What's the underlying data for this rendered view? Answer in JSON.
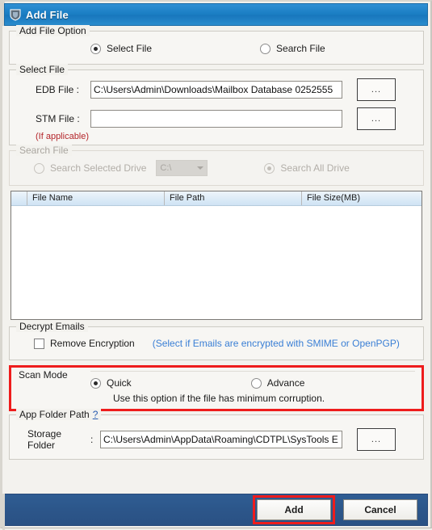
{
  "window": {
    "title": "Add File",
    "title_icon": "shield-icon"
  },
  "add_file_option": {
    "legend": "Add File Option",
    "options": [
      {
        "label": "Select File",
        "selected": true
      },
      {
        "label": "Search File",
        "selected": false
      }
    ]
  },
  "select_file": {
    "legend": "Select File",
    "edb": {
      "label": "EDB File :",
      "value": "C:\\Users\\Admin\\Downloads\\Mailbox Database 0252555",
      "browse_label": "..."
    },
    "stm": {
      "label": "STM File :",
      "value": "",
      "placeholder": "",
      "hint": "(If applicable)",
      "browse_label": "..."
    }
  },
  "search_file": {
    "legend": "Search File",
    "selected_drive_label": "Search Selected Drive",
    "drive_value": "C:\\",
    "all_drive_label": "Search All Drive",
    "selected_drive_checked": false,
    "all_drive_checked": true,
    "disabled": true
  },
  "file_list": {
    "columns": [
      "File Name",
      "File Path",
      "File Size(MB)"
    ],
    "rows": []
  },
  "decrypt_emails": {
    "legend": "Decrypt Emails",
    "checkbox_label": "Remove Encryption",
    "checked": false,
    "note": "(Select if Emails are encrypted with SMIME or OpenPGP)"
  },
  "scan_mode": {
    "legend": "Scan Mode",
    "options": [
      {
        "label": "Quick",
        "selected": true
      },
      {
        "label": "Advance",
        "selected": false
      }
    ],
    "description": "Use this option if the file has minimum corruption.",
    "highlighted": true
  },
  "app_folder_path": {
    "legend": "App Folder Path",
    "help_label": "?",
    "storage_label": "Storage Folder",
    "colon": ":",
    "storage_value": "C:\\Users\\Admin\\AppData\\Roaming\\CDTPL\\SysTools E",
    "browse_label": "..."
  },
  "footer": {
    "add_label": "Add",
    "cancel_label": "Cancel",
    "add_highlighted": true
  },
  "colors": {
    "titlebar": "#1b7fc4",
    "footer": "#2c568a",
    "highlight_red": "#ee1c1c",
    "link_blue": "#3a7fd5",
    "hint_red": "#b4262b"
  }
}
